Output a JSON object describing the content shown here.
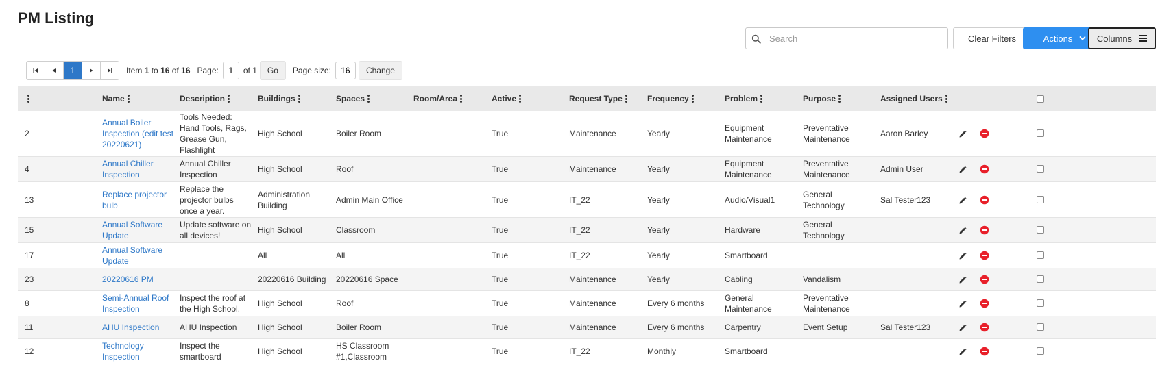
{
  "page": {
    "title": "PM Listing"
  },
  "toolbar": {
    "search_placeholder": "Search",
    "search_value": "",
    "clear_filters_label": "Clear Filters",
    "actions_label": "Actions",
    "columns_label": "Columns"
  },
  "pager": {
    "current_page": "1",
    "item_prefix": "Item",
    "item_from": "1",
    "item_to_word": "to",
    "item_to": "16",
    "item_of_word": "of",
    "item_total": "16",
    "page_label": "Page:",
    "page_value": "1",
    "page_of": "of 1",
    "go_label": "Go",
    "page_size_label": "Page size:",
    "page_size_value": "16",
    "change_label": "Change"
  },
  "columns": [
    "",
    "Name",
    "Description",
    "Buildings",
    "Spaces",
    "Room/Area",
    "Active",
    "Request Type",
    "Frequency",
    "Problem",
    "Purpose",
    "Assigned Users"
  ],
  "rows": [
    {
      "id": "2",
      "name": "Annual Boiler Inspection (edit test 20220621)",
      "description": "Tools Needed: Hand Tools, Rags, Grease Gun, Flashlight",
      "buildings": "High School",
      "spaces": "Boiler Room",
      "room": "",
      "active": "True",
      "request_type": "Maintenance",
      "frequency": "Yearly",
      "problem": "Equipment Maintenance",
      "purpose": "Preventative Maintenance",
      "assigned": "Aaron Barley"
    },
    {
      "id": "4",
      "name": "Annual Chiller Inspection",
      "description": "Annual Chiller Inspection",
      "buildings": "High School",
      "spaces": "Roof",
      "room": "",
      "active": "True",
      "request_type": "Maintenance",
      "frequency": "Yearly",
      "problem": "Equipment Maintenance",
      "purpose": "Preventative Maintenance",
      "assigned": "Admin User"
    },
    {
      "id": "13",
      "name": "Replace projector bulb",
      "description": "Replace the projector bulbs once a year.",
      "buildings": "Administration Building",
      "spaces": "Admin Main Office",
      "room": "",
      "active": "True",
      "request_type": "IT_22",
      "frequency": "Yearly",
      "problem": "Audio/Visual1",
      "purpose": "General Technology",
      "assigned": "Sal Tester123"
    },
    {
      "id": "15",
      "name": "Annual Software Update",
      "description": "Update software on all devices!",
      "buildings": "High School",
      "spaces": "Classroom",
      "room": "",
      "active": "True",
      "request_type": "IT_22",
      "frequency": "Yearly",
      "problem": "Hardware",
      "purpose": "General Technology",
      "assigned": ""
    },
    {
      "id": "17",
      "name": "Annual Software Update",
      "description": "",
      "buildings": "All",
      "spaces": "All",
      "room": "",
      "active": "True",
      "request_type": "IT_22",
      "frequency": "Yearly",
      "problem": "Smartboard",
      "purpose": "",
      "assigned": ""
    },
    {
      "id": "23",
      "name": "20220616 PM",
      "description": "",
      "buildings": "20220616 Building",
      "spaces": "20220616 Space",
      "room": "",
      "active": "True",
      "request_type": "Maintenance",
      "frequency": "Yearly",
      "problem": "Cabling",
      "purpose": "Vandalism",
      "assigned": ""
    },
    {
      "id": "8",
      "name": "Semi-Annual Roof Inspection",
      "description": "Inspect the roof at the High School.",
      "buildings": "High School",
      "spaces": "Roof",
      "room": "",
      "active": "True",
      "request_type": "Maintenance",
      "frequency": "Every 6 months",
      "problem": "General Maintenance",
      "purpose": "Preventative Maintenance",
      "assigned": ""
    },
    {
      "id": "11",
      "name": "AHU Inspection",
      "description": "AHU Inspection",
      "buildings": "High School",
      "spaces": "Boiler Room",
      "room": "",
      "active": "True",
      "request_type": "Maintenance",
      "frequency": "Every 6 months",
      "problem": "Carpentry",
      "purpose": "Event Setup",
      "assigned": "Sal Tester123"
    },
    {
      "id": "12",
      "name": "Technology Inspection",
      "description": "Inspect the smartboard",
      "buildings": "High School",
      "spaces": "HS Classroom #1,Classroom",
      "room": "",
      "active": "True",
      "request_type": "IT_22",
      "frequency": "Monthly",
      "problem": "Smartboard",
      "purpose": "",
      "assigned": ""
    }
  ],
  "colors": {
    "accent": "#2e8ff0",
    "link": "#2e78c8",
    "delete": "#e8202a",
    "header_bg": "#e9e9e9"
  }
}
